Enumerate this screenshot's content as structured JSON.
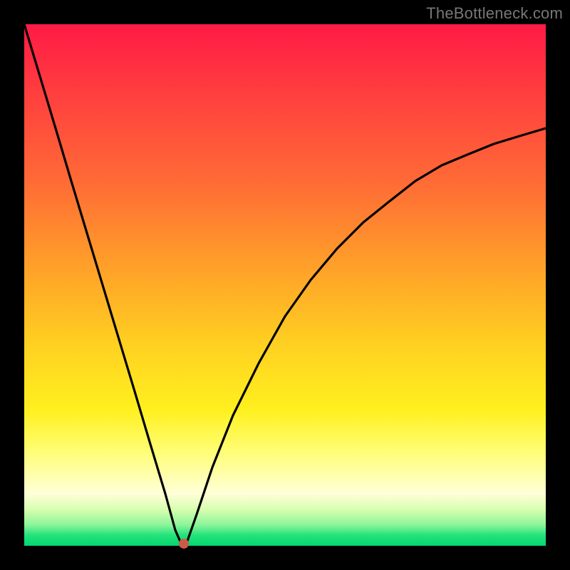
{
  "watermark": "TheBottleneck.com",
  "chart_data": {
    "type": "line",
    "title": "",
    "xlabel": "",
    "ylabel": "",
    "xlim": [
      0,
      100
    ],
    "ylim": [
      0,
      100
    ],
    "series": [
      {
        "name": "bottleneck-curve",
        "x": [
          0,
          3,
          6,
          9,
          12,
          15,
          18,
          21,
          24,
          27,
          29,
          30,
          31,
          33,
          36,
          40,
          45,
          50,
          55,
          60,
          65,
          70,
          75,
          80,
          85,
          90,
          95,
          100
        ],
        "values": [
          100,
          90,
          80,
          70,
          60,
          50,
          40,
          30,
          20,
          10,
          3,
          0.5,
          0.5,
          6,
          15,
          25,
          35,
          44,
          51,
          57,
          62,
          66,
          70,
          73,
          75,
          77,
          78.5,
          80
        ]
      }
    ],
    "marker": {
      "x": 30.5,
      "y": 0.5
    },
    "gradient_stops": [
      {
        "pos": 0,
        "color": "#ff1a45"
      },
      {
        "pos": 50,
        "color": "#ffb020"
      },
      {
        "pos": 80,
        "color": "#fff24a"
      },
      {
        "pos": 100,
        "color": "#04d66e"
      }
    ]
  }
}
